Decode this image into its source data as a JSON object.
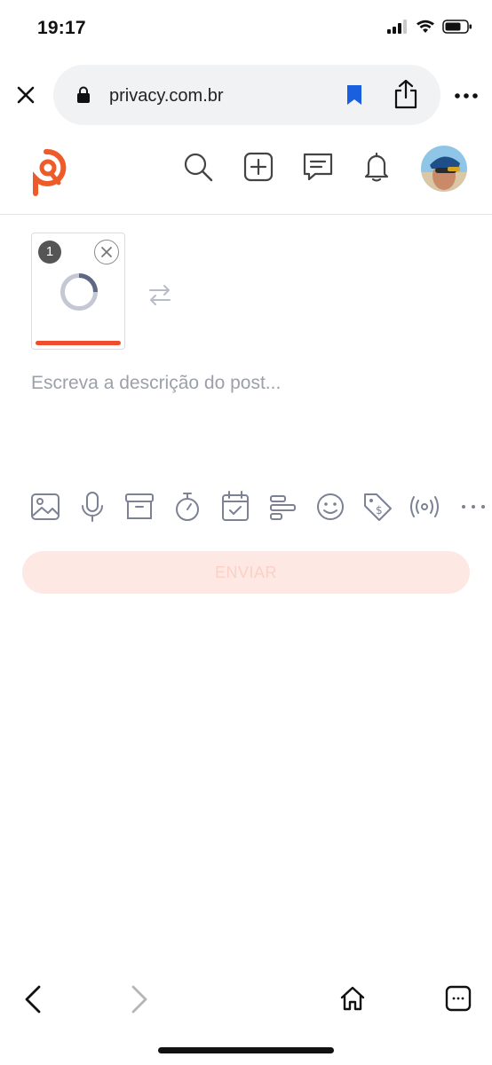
{
  "status_bar": {
    "time": "19:17",
    "icons": [
      "signal-icon",
      "wifi-icon",
      "battery-icon"
    ]
  },
  "browser": {
    "url": "privacy.com.br",
    "icons": [
      "close-icon",
      "lock-icon",
      "bookmark-icon",
      "share-icon",
      "more-icon"
    ],
    "bookmark_color": "#1a5fe0"
  },
  "app_header": {
    "icons": [
      "search-icon",
      "add-post-icon",
      "messages-icon",
      "notifications-icon",
      "avatar"
    ],
    "brand_color": "#ef5a2b"
  },
  "composer": {
    "media_count": "1",
    "upload_progress": 1.0,
    "description_placeholder": "Escreva a descrição do post...",
    "tools": [
      "image-icon",
      "microphone-icon",
      "archive-icon",
      "timer-icon",
      "calendar-icon",
      "poll-icon",
      "emoji-icon",
      "price-tag-icon",
      "live-icon",
      "more-icon"
    ],
    "send_label": "ENVIAR",
    "send_color": "#fde8e4"
  },
  "bottom_bar": {
    "icons": [
      "back-icon",
      "forward-icon",
      "home-icon",
      "tabs-icon"
    ]
  }
}
